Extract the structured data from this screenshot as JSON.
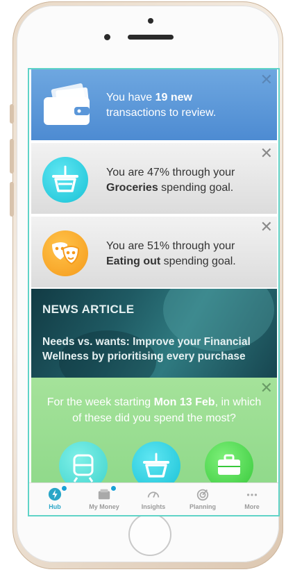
{
  "cards": {
    "transactions": {
      "prefix": "You have ",
      "highlight": "19 new",
      "suffix": "transactions to review."
    },
    "groceries": {
      "line1": "You are 47% through your",
      "highlight": "Groceries",
      "suffix": " spending goal."
    },
    "eating_out": {
      "line1": "You are 51% through your",
      "highlight": "Eating out",
      "suffix": " spending goal."
    },
    "close_symbol": "✕"
  },
  "news": {
    "label": "NEWS ARTICLE",
    "title": "Needs vs. wants: Improve your Financial Wellness by prioritising every purchase"
  },
  "quiz": {
    "prefix": "For the week starting ",
    "highlight": "Mon 13 Feb",
    "suffix": ", in which of these did you spend the most?"
  },
  "tabs": [
    {
      "label": "Hub",
      "icon": "lightning-icon",
      "active": true
    },
    {
      "label": "My Money",
      "icon": "wallet-icon",
      "active": false
    },
    {
      "label": "Insights",
      "icon": "gauge-icon",
      "active": false
    },
    {
      "label": "Planning",
      "icon": "target-icon",
      "active": false
    },
    {
      "label": "More",
      "icon": "more-dots-icon",
      "active": false
    }
  ],
  "colors": {
    "accent": "#2aa6c7",
    "transactions_card": "#5b97d9",
    "quiz_card": "#9ade92",
    "groceries_icon": "#19c2d6",
    "eating_out_icon": "#f59a1b"
  }
}
